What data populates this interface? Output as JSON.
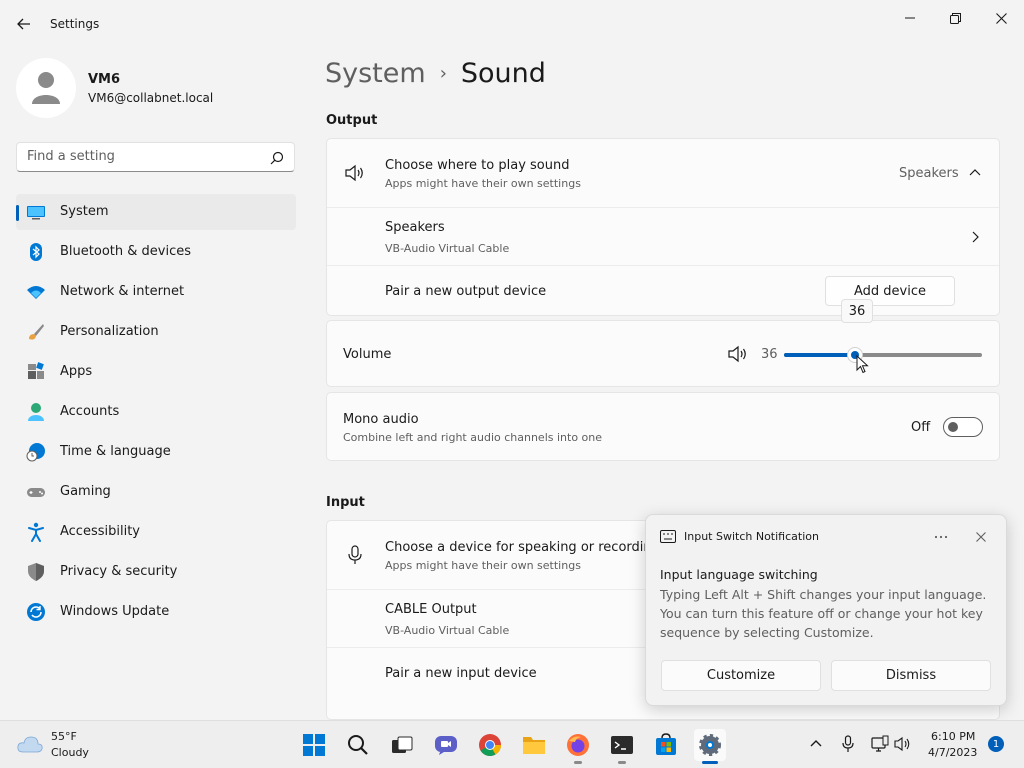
{
  "window": {
    "title": "Settings"
  },
  "profile": {
    "name": "VM6",
    "email": "VM6@collabnet.local"
  },
  "search": {
    "placeholder": "Find a setting"
  },
  "nav": {
    "items": [
      {
        "label": "System",
        "icon": "monitor-icon",
        "active": true
      },
      {
        "label": "Bluetooth & devices",
        "icon": "bluetooth-icon"
      },
      {
        "label": "Network & internet",
        "icon": "wifi-icon"
      },
      {
        "label": "Personalization",
        "icon": "brush-icon"
      },
      {
        "label": "Apps",
        "icon": "apps-icon"
      },
      {
        "label": "Accounts",
        "icon": "person-icon"
      },
      {
        "label": "Time & language",
        "icon": "globe-clock-icon"
      },
      {
        "label": "Gaming",
        "icon": "gamepad-icon"
      },
      {
        "label": "Accessibility",
        "icon": "accessibility-icon"
      },
      {
        "label": "Privacy & security",
        "icon": "shield-icon"
      },
      {
        "label": "Windows Update",
        "icon": "update-icon"
      }
    ]
  },
  "breadcrumb": {
    "parent": "System",
    "current": "Sound"
  },
  "output": {
    "section_title": "Output",
    "choose": {
      "title": "Choose where to play sound",
      "subtitle": "Apps might have their own settings",
      "value": "Speakers"
    },
    "device": {
      "title": "Speakers",
      "subtitle": "VB-Audio Virtual Cable"
    },
    "pair": {
      "title": "Pair a new output device",
      "button": "Add device"
    },
    "volume": {
      "label": "Volume",
      "value": "36",
      "tooltip": "36",
      "level": 36
    },
    "mono": {
      "title": "Mono audio",
      "subtitle": "Combine left and right audio channels into one",
      "state": "Off"
    }
  },
  "input": {
    "section_title": "Input",
    "choose": {
      "title": "Choose a device for speaking or recording",
      "subtitle": "Apps might have their own settings"
    },
    "device": {
      "title": "CABLE Output",
      "subtitle": "VB-Audio Virtual Cable"
    },
    "pair": {
      "title": "Pair a new input device"
    }
  },
  "notification": {
    "app": "Input Switch Notification",
    "heading": "Input language switching",
    "body": "Typing Left Alt + Shift changes your input language. You can turn this feature off or change your hot key sequence by selecting Customize.",
    "customize": "Customize",
    "dismiss": "Dismiss"
  },
  "taskbar": {
    "weather": {
      "temp": "55°F",
      "condition": "Cloudy"
    },
    "clock": {
      "time": "6:10 PM",
      "date": "4/7/2023"
    },
    "notification_count": "1"
  },
  "colors": {
    "accent": "#005fb8",
    "background": "#f3f3f3",
    "card": "#fbfbfb"
  }
}
